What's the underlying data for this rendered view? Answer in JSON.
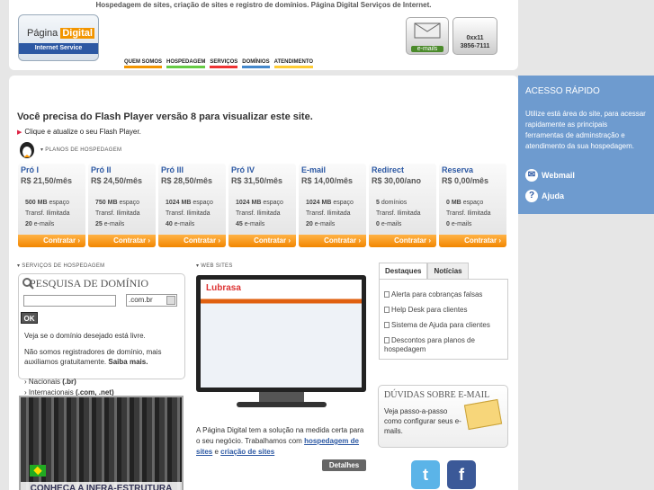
{
  "header": {
    "tagline": "Hospedagem de sites, criação de sites e registro de domínios. Página Digital Serviços de Internet.",
    "logo_text_a": "Página",
    "logo_text_b": "Digital",
    "logo_sub": "Internet Service",
    "nav": [
      "QUEM SOMOS",
      "HOSPEDAGEM",
      "SERVIÇOS",
      "DOMÍNIOS",
      "ATENDIMENTO"
    ],
    "email_label": "e-mails",
    "phone_line1": "0xx11",
    "phone_line2": "3856-7111"
  },
  "sidebar": {
    "title": "ACESSO RÁPIDO",
    "text": "Utilize está área do site, para acessar rapidamente as principais ferramentas de adminstração e atendimento da sua hospedagem.",
    "webmail": "Webmail",
    "help": "Ajuda"
  },
  "flash": {
    "title": "Você precisa do Flash Player versão 8 para visualizar este site.",
    "link": "Clique e atualize o seu Flash Player."
  },
  "plans_header": "PLANOS DE HOSPEDAGEM",
  "plans": [
    {
      "name": "Pró I",
      "price": "R$ 21,50/mês",
      "space": "500 MB",
      "space_unit": "espaço",
      "transf": "Transf. Ilimitada",
      "emails": "20",
      "emails_unit": "e-mails",
      "cta": "Contratar"
    },
    {
      "name": "Pró II",
      "price": "R$ 24,50/mês",
      "space": "750 MB",
      "space_unit": "espaço",
      "transf": "Transf. Ilimitada",
      "emails": "25",
      "emails_unit": "e-mails",
      "cta": "Contratar"
    },
    {
      "name": "Pró III",
      "price": "R$ 28,50/mês",
      "space": "1024 MB",
      "space_unit": "espaço",
      "transf": "Transf. Ilimitada",
      "emails": "40",
      "emails_unit": "e-mails",
      "cta": "Contratar"
    },
    {
      "name": "Pró IV",
      "price": "R$ 31,50/mês",
      "space": "1024 MB",
      "space_unit": "espaço",
      "transf": "Transf. Ilimitada",
      "emails": "45",
      "emails_unit": "e-mails",
      "cta": "Contratar"
    },
    {
      "name": "E-mail",
      "price": "R$ 14,00/mês",
      "space": "1024 MB",
      "space_unit": "espaço",
      "transf": "Transf. Ilimitada",
      "emails": "20",
      "emails_unit": "e-mails",
      "cta": "Contratar"
    },
    {
      "name": "Redirect",
      "price": "R$ 30,00/ano",
      "space": "5",
      "space_unit": "domínios",
      "transf": "Transf. Ilimitada",
      "emails": "0",
      "emails_unit": "e-mails",
      "cta": "Contratar"
    },
    {
      "name": "Reserva",
      "price": "R$ 0,00/mês",
      "space": "0 MB",
      "space_unit": "espaço",
      "transf": "Transf. Ilimitada",
      "emails": "0",
      "emails_unit": "e-mails",
      "cta": "Contratar"
    }
  ],
  "domain": {
    "section": "SERVIÇOS DE HOSPEDAGEM",
    "title": "PESQUISA DE DOMÍNIO",
    "input_value": "",
    "tld": ".com.br",
    "ok": "OK",
    "p1": "Veja se o domínio desejado está livre.",
    "p2": "Não somos registradores de domínio, mais auxiliamos gratuitamente.",
    "p2_link": "Saiba mais.",
    "nac_label": "Nacionais",
    "nac_value": "(.br)",
    "int_label": "Internacionais",
    "int_value": "(.com, .net)",
    "infra": "CONHEÇA A INFRA-ESTRUTURA"
  },
  "websites": {
    "section": "WEB SITES",
    "screen_brand": "Lubrasa",
    "text": "A Página Digital tem a solução na medida certa para o seu negócio. Trabalhamos com",
    "link1": "hospedagem de sites",
    "and": "e",
    "link2": "criação de sites",
    "details": "Detalhes"
  },
  "news": {
    "tabs": [
      "Destaques",
      "Notícias"
    ],
    "items": [
      "Alerta para cobranças falsas",
      "Help Desk para clientes",
      "Sistema de Ajuda para clientes",
      "Descontos para planos de hospedagem"
    ]
  },
  "duvidas": {
    "title": "DÚVIDAS SOBRE E-MAIL",
    "text": "Veja passo-a-passo como configurar seus e-mails."
  },
  "colors": {
    "accent": "#f28600",
    "brand": "#2c58a3",
    "sidebar": "#6e9bcf"
  }
}
